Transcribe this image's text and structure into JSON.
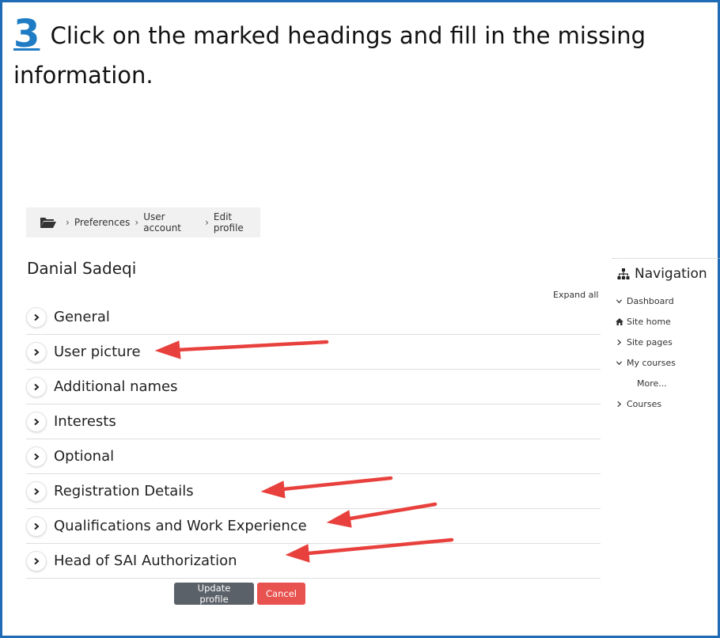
{
  "instruction": {
    "step_number": "3",
    "text": "Click on the marked headings and fill in the missing information."
  },
  "breadcrumb": {
    "items": [
      "Preferences",
      "User account",
      "Edit profile"
    ],
    "separator": "›"
  },
  "profile": {
    "name": "Danial Sadeqi"
  },
  "expand_all_label": "Expand all",
  "sections": [
    {
      "label": "General"
    },
    {
      "label": "User picture"
    },
    {
      "label": "Additional names"
    },
    {
      "label": "Interests"
    },
    {
      "label": "Optional"
    },
    {
      "label": "Registration Details"
    },
    {
      "label": "Qualifications and Work Experience"
    },
    {
      "label": "Head of SAI Authorization"
    }
  ],
  "buttons": {
    "update_label": "Update profile",
    "cancel_label": "Cancel"
  },
  "navigation": {
    "title": "Navigation",
    "items": [
      {
        "label": "Dashboard",
        "icon": "chevron-down-icon"
      },
      {
        "label": "Site home",
        "icon": "home-icon"
      },
      {
        "label": "Site pages",
        "icon": "chevron-right-icon"
      },
      {
        "label": "My courses",
        "icon": "chevron-down-icon"
      },
      {
        "label": "More...",
        "icon": "none"
      },
      {
        "label": "Courses",
        "icon": "chevron-right-icon"
      }
    ]
  },
  "colors": {
    "frame": "#1f6bb6",
    "step_number": "#1f7cc4",
    "arrow": "#e8413d",
    "update_button": "#5a6168",
    "cancel_button": "#e8524f"
  }
}
